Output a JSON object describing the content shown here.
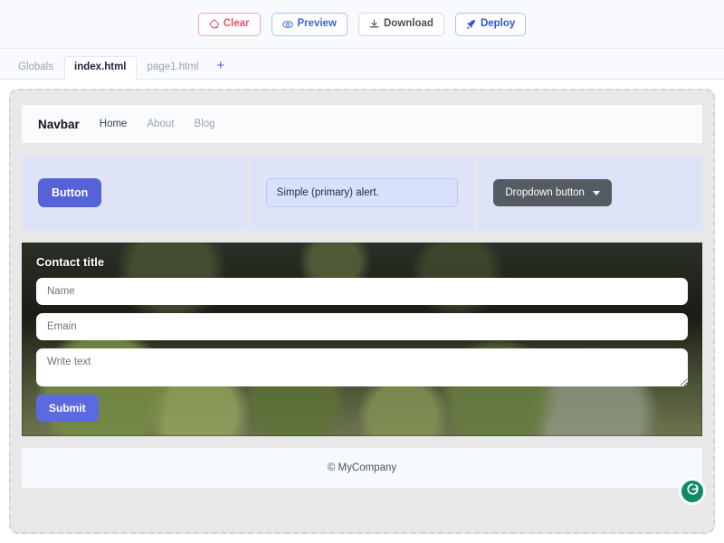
{
  "toolbar": {
    "buttons": [
      {
        "label": "Clear",
        "icon": "eraser-icon",
        "accent": "#e8536b"
      },
      {
        "label": "Preview",
        "icon": "eye-icon",
        "accent": "#3f63dd"
      },
      {
        "label": "Download",
        "icon": "download-icon",
        "accent": "#4a4f58"
      },
      {
        "label": "Deploy",
        "icon": "rocket-icon",
        "accent": "#2f55d4"
      }
    ]
  },
  "tabs": {
    "items": [
      {
        "label": "Globals",
        "active": false
      },
      {
        "label": "index.html",
        "active": true
      },
      {
        "label": "page1.html",
        "active": false
      }
    ],
    "add_label": "+"
  },
  "canvas": {
    "navbar": {
      "brand": "Navbar",
      "links": [
        {
          "label": "Home",
          "current": true
        },
        {
          "label": "About",
          "current": false
        },
        {
          "label": "Blog",
          "current": false
        }
      ]
    },
    "columns": {
      "button_label": "Button",
      "alert_text": "Simple (primary) alert.",
      "dropdown_label": "Dropdown button"
    },
    "contact": {
      "title": "Contact title",
      "name_placeholder": "Name",
      "email_placeholder": "Emain",
      "message_placeholder": "Write text",
      "submit_label": "Submit"
    },
    "footer": {
      "text": "© MyCompany"
    }
  },
  "badge": {
    "name": "grammarly-icon",
    "color": "#0e8a69"
  }
}
